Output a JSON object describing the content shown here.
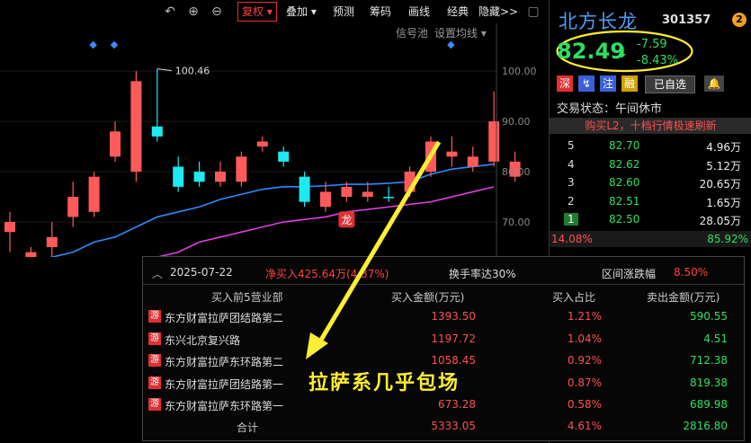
{
  "toolbar": {
    "items": [
      "复权",
      "叠加",
      "预测",
      "筹码",
      "画线",
      "经典",
      "隐藏>>"
    ]
  },
  "chart_tools": {
    "signal_pool": "信号池",
    "ma_settings": "设置均线"
  },
  "chart_data": {
    "type": "candlestick",
    "ylim": [
      65,
      107
    ],
    "yticks": [
      "100.00",
      "90.00",
      "80.00",
      "70.00"
    ],
    "peak_label": "100.46",
    "marker_label": "龙",
    "candles": [
      {
        "o": 68,
        "c": 70,
        "h": 72,
        "l": 64,
        "color": "up"
      },
      {
        "o": 61,
        "c": 64,
        "h": 65,
        "l": 59,
        "color": "up"
      },
      {
        "o": 65,
        "c": 67,
        "h": 70,
        "l": 63,
        "color": "up"
      },
      {
        "o": 71,
        "c": 75,
        "h": 78,
        "l": 69,
        "color": "up"
      },
      {
        "o": 72,
        "c": 79,
        "h": 80,
        "l": 71,
        "color": "up"
      },
      {
        "o": 83,
        "c": 88,
        "h": 90,
        "l": 82,
        "color": "up"
      },
      {
        "o": 80,
        "c": 98,
        "h": 100,
        "l": 78,
        "color": "up"
      },
      {
        "o": 87,
        "c": 89,
        "h": 100.46,
        "l": 86,
        "color": "cyan"
      },
      {
        "o": 81,
        "c": 77,
        "h": 83,
        "l": 76,
        "color": "cyan"
      },
      {
        "o": 80,
        "c": 78,
        "h": 82,
        "l": 77,
        "color": "cyan"
      },
      {
        "o": 78,
        "c": 80,
        "h": 82,
        "l": 77,
        "color": "up"
      },
      {
        "o": 78,
        "c": 83,
        "h": 84,
        "l": 77,
        "color": "up"
      },
      {
        "o": 85,
        "c": 86,
        "h": 87,
        "l": 84,
        "color": "up"
      },
      {
        "o": 84,
        "c": 82,
        "h": 85,
        "l": 81,
        "color": "cyan"
      },
      {
        "o": 79,
        "c": 74,
        "h": 80,
        "l": 73,
        "color": "cyan"
      },
      {
        "o": 73,
        "c": 76,
        "h": 78,
        "l": 72,
        "color": "up"
      },
      {
        "o": 75,
        "c": 77,
        "h": 78,
        "l": 74,
        "color": "up"
      },
      {
        "o": 75,
        "c": 76,
        "h": 78,
        "l": 74,
        "color": "up"
      },
      {
        "o": 75,
        "c": 75,
        "h": 77,
        "l": 74,
        "color": "cyan"
      },
      {
        "o": 76,
        "c": 80,
        "h": 81,
        "l": 75,
        "color": "up"
      },
      {
        "o": 80,
        "c": 86,
        "h": 87,
        "l": 79,
        "color": "up"
      },
      {
        "o": 83,
        "c": 84,
        "h": 87,
        "l": 81,
        "color": "up"
      },
      {
        "o": 81,
        "c": 83,
        "h": 85,
        "l": 80,
        "color": "up"
      },
      {
        "o": 82,
        "c": 90,
        "h": 96,
        "l": 81,
        "color": "up"
      },
      {
        "o": 82,
        "c": 79,
        "h": 84,
        "l": 78,
        "color": "up"
      }
    ],
    "ma_blue": [
      61,
      62,
      63,
      64,
      66,
      67,
      69,
      71,
      72,
      73,
      74.5,
      75.5,
      76.5,
      77,
      77,
      77.2,
      77.5,
      77.5,
      77.7,
      78,
      79.5,
      80.5,
      81,
      81.5
    ],
    "ma_magenta": [
      55,
      56,
      57,
      58,
      59,
      60,
      62,
      63,
      64,
      66,
      67,
      68,
      69,
      70,
      70.5,
      71,
      72,
      72.5,
      73,
      73.5,
      74,
      75,
      76,
      77
    ]
  },
  "quote": {
    "name": "北方长龙",
    "code": "301357",
    "badge": "2",
    "price": "82.49",
    "arrow": "⬇",
    "change": "-7.59",
    "change_pct": "-8.43%",
    "tags": [
      "深",
      "↯",
      "注",
      "融",
      "已自选",
      "🔔"
    ],
    "status": "交易状态：午间休市",
    "notice": "购买L2，十档行情极速刷新"
  },
  "orderbook": [
    {
      "level": "5",
      "price": "82.70",
      "vol": "4.96万"
    },
    {
      "level": "4",
      "price": "82.62",
      "vol": "5.12万"
    },
    {
      "level": "3",
      "price": "82.60",
      "vol": "20.65万"
    },
    {
      "level": "2",
      "price": "82.51",
      "vol": "1.65万"
    },
    {
      "level": "1",
      "price": "82.50",
      "vol": "28.05万"
    }
  ],
  "ratio": {
    "left": "14.08%",
    "right": "85.92%"
  },
  "panel": {
    "date": "2025-07-22",
    "net_buy": "净买入425.64万(4.37%)",
    "turnover": "换手率达30%",
    "range_label": "区间涨跌幅",
    "range_value": "8.50%",
    "headers": [
      "买入前5营业部",
      "买入金额(万元)",
      "买入占比",
      "卖出金额(万元)"
    ],
    "rows": [
      {
        "name": "东方财富拉萨团结路第二",
        "buy": "1393.50",
        "pct": "1.21%",
        "sell": "590.55"
      },
      {
        "name": "东兴北京复兴路",
        "buy": "1197.72",
        "pct": "1.04%",
        "sell": "4.51"
      },
      {
        "name": "东方财富拉萨东环路第二",
        "buy": "1058.45",
        "pct": "0.92%",
        "sell": "712.38"
      },
      {
        "name": "东方财富拉萨团结路第一",
        "buy": "",
        "pct": "0.87%",
        "sell": "819.38"
      },
      {
        "name": "东方财富拉萨东环路第一",
        "buy": "673.28",
        "pct": "0.58%",
        "sell": "689.98"
      }
    ],
    "total": {
      "label": "合计",
      "buy": "5333.05",
      "pct": "4.61%",
      "sell": "2816.80"
    },
    "you_tag": "游"
  },
  "callout": "拉萨系几乎包场",
  "colors": {
    "up": "#ff5a5a",
    "cyan": "#1ee8f0",
    "green": "#2ee060",
    "blue": "#2a8cff",
    "magenta": "#e040e0",
    "yellow": "#ffee33"
  }
}
